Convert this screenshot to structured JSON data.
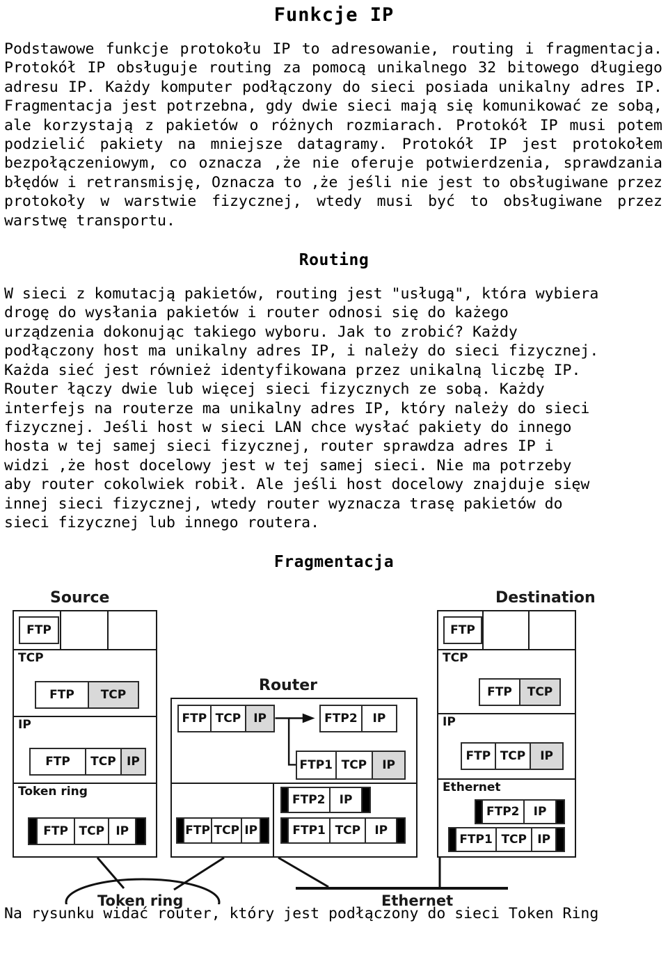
{
  "document": {
    "title": "Funkcje IP",
    "intro_paragraph": "Podstawowe funkcje protokołu IP to adresowanie, routing i fragmentacja. Protokół IP obsługuje routing za pomocą unikalnego 32 bitowego długiego adresu IP. Każdy komputer podłączony do sieci posiada unikalny adres IP. Fragmentacja jest potrzebna, gdy dwie sieci mają się komunikować ze sobą, ale korzystają z pakietów o różnych rozmiarach. Protokół IP musi potem podzielić pakiety na mniejsze datagramy. Protokół IP jest protokołem bezpołączeniowym, co oznacza ,że nie oferuje potwierdzenia, sprawdzania błędów i retransmisję, Oznacza to ,że jeśli nie jest to obsługiwane przez protokoły w warstwie fizycznej, wtedy musi być to obsługiwane przez warstwę transportu.",
    "routing_heading": "Routing",
    "routing_paragraph": "W sieci z komutacją pakietów, routing jest \"usługą\", która wybiera\ndrogę do wysłania pakietów i router odnosi się do każego\nurządzenia dokonując takiego wyboru. Jak to zrobić? Każdy\npodłączony host ma unikalny adres IP, i należy do sieci fizycznej.\nKażda sieć jest również identyfikowana przez unikalną liczbę IP.\nRouter łączy dwie lub więcej sieci fizycznych ze sobą. Każdy\ninterfejs na routerze ma unikalny adres IP, który należy do sieci\nfizycznej. Jeśli host w sieci LAN chce wysłać pakiety do innego\nhosta w tej samej sieci fizycznej, router sprawdza adres IP i\nwidzi ,że host docelowy jest w tej samej sieci. Nie ma potrzeby\naby router cokolwiek robił. Ale jeśli host docelowy znajduje sięw\ninnej sieci fizycznej, wtedy router wyznacza trasę pakietów do\nsieci fizycznej lub innego routera.",
    "fragmentation_heading": "Fragmentacja",
    "caption": "Na rysunku widać router, który jest podłączony do sieci Token Ring"
  },
  "diagram": {
    "source_label": "Source",
    "router_label": "Router",
    "destination_label": "Destination",
    "token_ring_label": "Token ring",
    "ethernet_label": "Ethernet",
    "source": {
      "app_layer": {
        "packet": [
          "FTP"
        ]
      },
      "tcp_layer": {
        "name": "TCP",
        "packet": [
          "FTP",
          "TCP"
        ]
      },
      "ip_layer": {
        "name": "IP",
        "packet": [
          "FTP",
          "TCP",
          "IP"
        ]
      },
      "link_layer": {
        "name": "Token ring",
        "packet": [
          "FTP",
          "TCP",
          "IP"
        ]
      }
    },
    "router": {
      "in_packet": [
        "FTP",
        "TCP",
        "IP"
      ],
      "frag_packet_a": [
        "FTP2",
        "IP"
      ],
      "frag_packet_b": [
        "FTP1",
        "TCP",
        "IP"
      ],
      "token_ring_packet": [
        "FTP",
        "TCP",
        "IP"
      ],
      "eth_packet_a": [
        "FTP2",
        "IP"
      ],
      "eth_packet_b": [
        "FTP1",
        "TCP",
        "IP"
      ]
    },
    "destination": {
      "app_layer": {
        "packet": [
          "FTP"
        ]
      },
      "tcp_layer": {
        "name": "TCP",
        "packet": [
          "FTP",
          "TCP"
        ]
      },
      "ip_layer": {
        "name": "IP",
        "packet": [
          "FTP",
          "TCP",
          "IP"
        ]
      },
      "link_layer": {
        "name": "Ethernet",
        "packet_a": [
          "FTP2",
          "IP"
        ],
        "packet_b": [
          "FTP1",
          "TCP",
          "IP"
        ]
      }
    }
  },
  "colors": {
    "ink": "#000000",
    "gray_fill": "#d9d9d9",
    "paper": "#ffffff"
  }
}
